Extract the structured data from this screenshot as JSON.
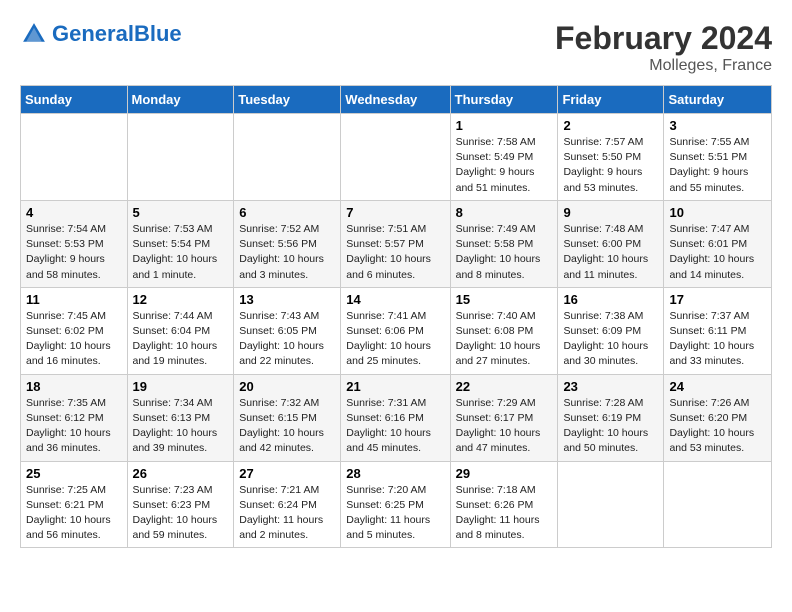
{
  "header": {
    "logo_general": "General",
    "logo_blue": "Blue",
    "title": "February 2024",
    "location": "Molleges, France"
  },
  "days_of_week": [
    "Sunday",
    "Monday",
    "Tuesday",
    "Wednesday",
    "Thursday",
    "Friday",
    "Saturday"
  ],
  "weeks": [
    [
      {
        "day": "",
        "info": ""
      },
      {
        "day": "",
        "info": ""
      },
      {
        "day": "",
        "info": ""
      },
      {
        "day": "",
        "info": ""
      },
      {
        "day": "1",
        "info": "Sunrise: 7:58 AM\nSunset: 5:49 PM\nDaylight: 9 hours\nand 51 minutes."
      },
      {
        "day": "2",
        "info": "Sunrise: 7:57 AM\nSunset: 5:50 PM\nDaylight: 9 hours\nand 53 minutes."
      },
      {
        "day": "3",
        "info": "Sunrise: 7:55 AM\nSunset: 5:51 PM\nDaylight: 9 hours\nand 55 minutes."
      }
    ],
    [
      {
        "day": "4",
        "info": "Sunrise: 7:54 AM\nSunset: 5:53 PM\nDaylight: 9 hours\nand 58 minutes."
      },
      {
        "day": "5",
        "info": "Sunrise: 7:53 AM\nSunset: 5:54 PM\nDaylight: 10 hours\nand 1 minute."
      },
      {
        "day": "6",
        "info": "Sunrise: 7:52 AM\nSunset: 5:56 PM\nDaylight: 10 hours\nand 3 minutes."
      },
      {
        "day": "7",
        "info": "Sunrise: 7:51 AM\nSunset: 5:57 PM\nDaylight: 10 hours\nand 6 minutes."
      },
      {
        "day": "8",
        "info": "Sunrise: 7:49 AM\nSunset: 5:58 PM\nDaylight: 10 hours\nand 8 minutes."
      },
      {
        "day": "9",
        "info": "Sunrise: 7:48 AM\nSunset: 6:00 PM\nDaylight: 10 hours\nand 11 minutes."
      },
      {
        "day": "10",
        "info": "Sunrise: 7:47 AM\nSunset: 6:01 PM\nDaylight: 10 hours\nand 14 minutes."
      }
    ],
    [
      {
        "day": "11",
        "info": "Sunrise: 7:45 AM\nSunset: 6:02 PM\nDaylight: 10 hours\nand 16 minutes."
      },
      {
        "day": "12",
        "info": "Sunrise: 7:44 AM\nSunset: 6:04 PM\nDaylight: 10 hours\nand 19 minutes."
      },
      {
        "day": "13",
        "info": "Sunrise: 7:43 AM\nSunset: 6:05 PM\nDaylight: 10 hours\nand 22 minutes."
      },
      {
        "day": "14",
        "info": "Sunrise: 7:41 AM\nSunset: 6:06 PM\nDaylight: 10 hours\nand 25 minutes."
      },
      {
        "day": "15",
        "info": "Sunrise: 7:40 AM\nSunset: 6:08 PM\nDaylight: 10 hours\nand 27 minutes."
      },
      {
        "day": "16",
        "info": "Sunrise: 7:38 AM\nSunset: 6:09 PM\nDaylight: 10 hours\nand 30 minutes."
      },
      {
        "day": "17",
        "info": "Sunrise: 7:37 AM\nSunset: 6:11 PM\nDaylight: 10 hours\nand 33 minutes."
      }
    ],
    [
      {
        "day": "18",
        "info": "Sunrise: 7:35 AM\nSunset: 6:12 PM\nDaylight: 10 hours\nand 36 minutes."
      },
      {
        "day": "19",
        "info": "Sunrise: 7:34 AM\nSunset: 6:13 PM\nDaylight: 10 hours\nand 39 minutes."
      },
      {
        "day": "20",
        "info": "Sunrise: 7:32 AM\nSunset: 6:15 PM\nDaylight: 10 hours\nand 42 minutes."
      },
      {
        "day": "21",
        "info": "Sunrise: 7:31 AM\nSunset: 6:16 PM\nDaylight: 10 hours\nand 45 minutes."
      },
      {
        "day": "22",
        "info": "Sunrise: 7:29 AM\nSunset: 6:17 PM\nDaylight: 10 hours\nand 47 minutes."
      },
      {
        "day": "23",
        "info": "Sunrise: 7:28 AM\nSunset: 6:19 PM\nDaylight: 10 hours\nand 50 minutes."
      },
      {
        "day": "24",
        "info": "Sunrise: 7:26 AM\nSunset: 6:20 PM\nDaylight: 10 hours\nand 53 minutes."
      }
    ],
    [
      {
        "day": "25",
        "info": "Sunrise: 7:25 AM\nSunset: 6:21 PM\nDaylight: 10 hours\nand 56 minutes."
      },
      {
        "day": "26",
        "info": "Sunrise: 7:23 AM\nSunset: 6:23 PM\nDaylight: 10 hours\nand 59 minutes."
      },
      {
        "day": "27",
        "info": "Sunrise: 7:21 AM\nSunset: 6:24 PM\nDaylight: 11 hours\nand 2 minutes."
      },
      {
        "day": "28",
        "info": "Sunrise: 7:20 AM\nSunset: 6:25 PM\nDaylight: 11 hours\nand 5 minutes."
      },
      {
        "day": "29",
        "info": "Sunrise: 7:18 AM\nSunset: 6:26 PM\nDaylight: 11 hours\nand 8 minutes."
      },
      {
        "day": "",
        "info": ""
      },
      {
        "day": "",
        "info": ""
      }
    ]
  ]
}
